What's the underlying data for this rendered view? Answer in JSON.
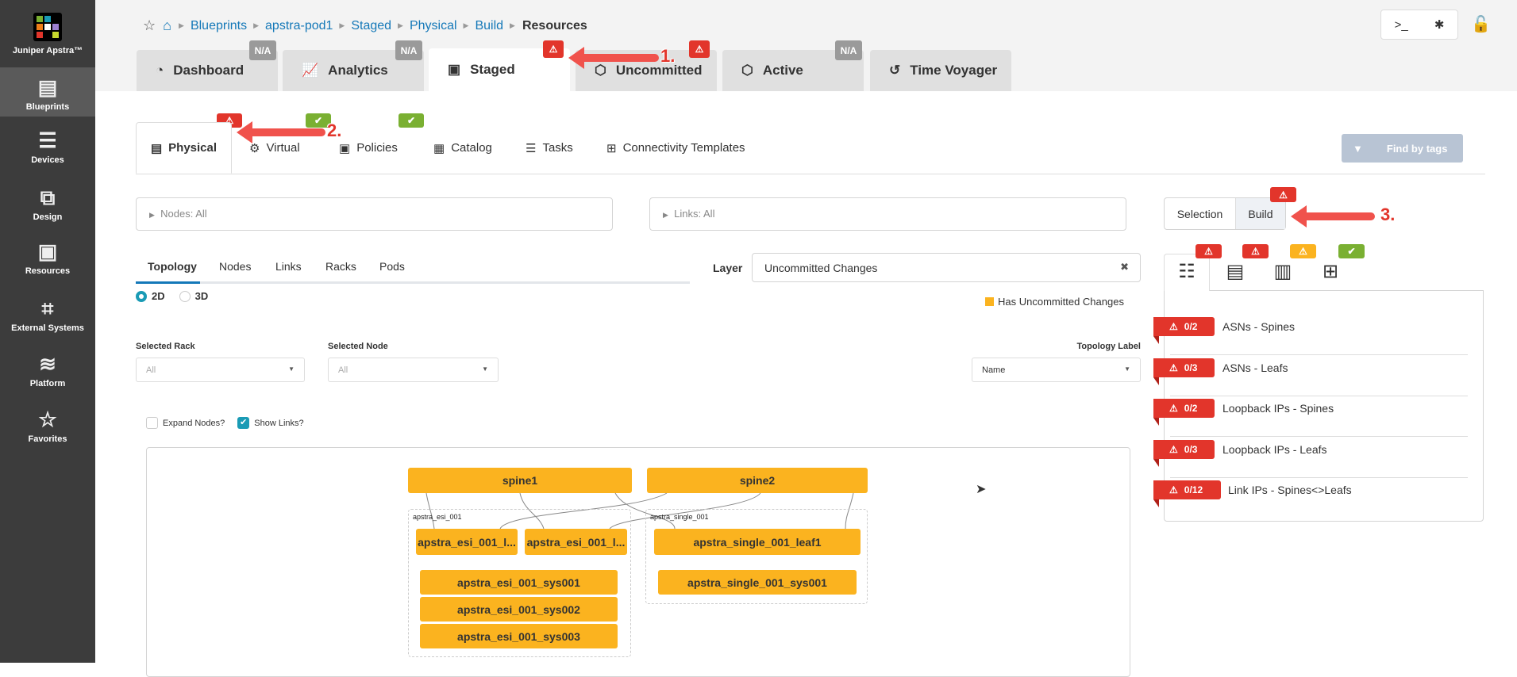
{
  "sidebar": {
    "brand": "Juniper Apstra™",
    "items": [
      {
        "label": "Blueprints",
        "icon": "blueprints-icon"
      },
      {
        "label": "Devices",
        "icon": "devices-icon"
      },
      {
        "label": "Design",
        "icon": "design-icon"
      },
      {
        "label": "Resources",
        "icon": "resources-icon"
      },
      {
        "label": "External Systems",
        "icon": "external-systems-icon"
      },
      {
        "label": "Platform",
        "icon": "platform-icon"
      },
      {
        "label": "Favorites",
        "icon": "star-icon"
      }
    ]
  },
  "breadcrumb": [
    "Blueprints",
    "apstra-pod1",
    "Staged",
    "Physical",
    "Build"
  ],
  "breadcrumb_current": "Resources",
  "top_tabs": [
    {
      "label": "Dashboard",
      "badge": "N/A"
    },
    {
      "label": "Analytics",
      "badge": "N/A"
    },
    {
      "label": "Staged",
      "badge": "warning"
    },
    {
      "label": "Uncommitted",
      "badge": "warning"
    },
    {
      "label": "Active",
      "badge": "N/A"
    },
    {
      "label": "Time Voyager"
    }
  ],
  "sub_tabs": [
    {
      "label": "Physical",
      "badge": "warning"
    },
    {
      "label": "Virtual",
      "badge": "ok"
    },
    {
      "label": "Policies",
      "badge": "ok"
    },
    {
      "label": "Catalog"
    },
    {
      "label": "Tasks"
    },
    {
      "label": "Connectivity Templates"
    }
  ],
  "find_by_tags": "Find by tags",
  "filters": {
    "nodes": "Nodes: All",
    "links": "Links: All"
  },
  "view_tabs": [
    "Topology",
    "Nodes",
    "Links",
    "Racks",
    "Pods"
  ],
  "layer": {
    "label": "Layer",
    "value": "Uncommitted Changes",
    "legend": "Has Uncommitted Changes",
    "legend_color": "#fbb31f"
  },
  "dim": {
    "option_2d": "2D",
    "option_3d": "3D",
    "selected": "2D"
  },
  "selected_rack": {
    "label": "Selected Rack",
    "value": "All"
  },
  "selected_node": {
    "label": "Selected Node",
    "value": "All"
  },
  "topology_label": {
    "label": "Topology Label",
    "value": "Name"
  },
  "expand_nodes": {
    "label": "Expand Nodes?",
    "checked": false
  },
  "show_links": {
    "label": "Show Links?",
    "checked": true
  },
  "topology": {
    "spines": [
      "spine1",
      "spine2"
    ],
    "groups": [
      {
        "name": "apstra_esi_001",
        "leafs": [
          "apstra_esi_001_l...",
          "apstra_esi_001_l..."
        ],
        "systems": [
          "apstra_esi_001_sys001",
          "apstra_esi_001_sys002",
          "apstra_esi_001_sys003"
        ]
      },
      {
        "name": "apstra_single_001",
        "leafs": [
          "apstra_single_001_leaf1"
        ],
        "systems": [
          "apstra_single_001_sys001"
        ]
      }
    ]
  },
  "mode_toggle": {
    "selection": "Selection",
    "build": "Build",
    "active": "Build"
  },
  "build_tabs": [
    {
      "icon": "list-icon",
      "badge": "warning",
      "status_color": "#e2352b"
    },
    {
      "icon": "server-stack-icon",
      "badge": "warning",
      "status_color": "#e2352b"
    },
    {
      "icon": "device-profile-icon",
      "badge": "warning",
      "status_color": "#fbb31f"
    },
    {
      "icon": "topology-icon",
      "badge": "ok",
      "status_color": "#7ab032"
    }
  ],
  "resources": [
    {
      "count": "0/2",
      "label": "ASNs - Spines"
    },
    {
      "count": "0/3",
      "label": "ASNs - Leafs"
    },
    {
      "count": "0/2",
      "label": "Loopback IPs - Spines"
    },
    {
      "count": "0/3",
      "label": "Loopback IPs - Leafs"
    },
    {
      "count": "0/12",
      "label": "Link IPs - Spines<>Leafs"
    }
  ],
  "annotations": [
    "1.",
    "2.",
    "3."
  ]
}
